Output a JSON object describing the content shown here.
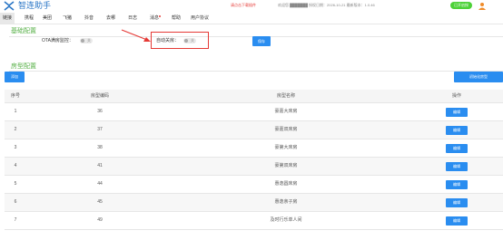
{
  "header": {
    "logo_caption": "智连",
    "app_name": "智连助手",
    "notice": "请点击下载插件",
    "userinfo": "欢迎您 ███████ 授权日期：2026-10-21  最新版本：1.0.46",
    "auto_toggle_label": "已开启授"
  },
  "nav": {
    "items": [
      {
        "label": "链接",
        "active": true
      },
      {
        "label": "携程"
      },
      {
        "label": "美团"
      },
      {
        "label": "飞猪"
      },
      {
        "label": "抖音"
      },
      {
        "label": "去哪"
      },
      {
        "label": "日志"
      },
      {
        "label": "消息"
      },
      {
        "label": "帮助"
      },
      {
        "label": "用户协议"
      }
    ]
  },
  "basic_config": {
    "title": "基础配置",
    "ota_label": "OTA满房监控：",
    "ota_toggle": "关",
    "auto_close_label": "自动关房：",
    "auto_close_toggle": "关",
    "save_label": "保存"
  },
  "room_config": {
    "title": "房型配置",
    "add_label": "添加",
    "init_label": "初始化房型"
  },
  "table": {
    "headers": [
      "序号",
      "房型编码",
      "房型名称",
      "操作"
    ],
    "rows": [
      {
        "no": "1",
        "code": "36",
        "name": "豪嘉大床房",
        "action": "编辑"
      },
      {
        "no": "2",
        "code": "37",
        "name": "豪嘉双床房",
        "action": "编辑"
      },
      {
        "no": "3",
        "code": "38",
        "name": "豪第大床房",
        "action": "编辑"
      },
      {
        "no": "4",
        "code": "41",
        "name": "豪第双床房",
        "action": "编辑"
      },
      {
        "no": "5",
        "code": "44",
        "name": "惠逸圆床房",
        "action": "编辑"
      },
      {
        "no": "6",
        "code": "45",
        "name": "惠逸亲子房",
        "action": "编辑"
      },
      {
        "no": "7",
        "code": "49",
        "name": "及时行乐单人间",
        "action": "编辑"
      }
    ]
  },
  "colors": {
    "primary": "#2a8df0",
    "section_green": "#5ab24a",
    "highlight_red": "#e53935",
    "toggle_green": "#4cd137"
  }
}
